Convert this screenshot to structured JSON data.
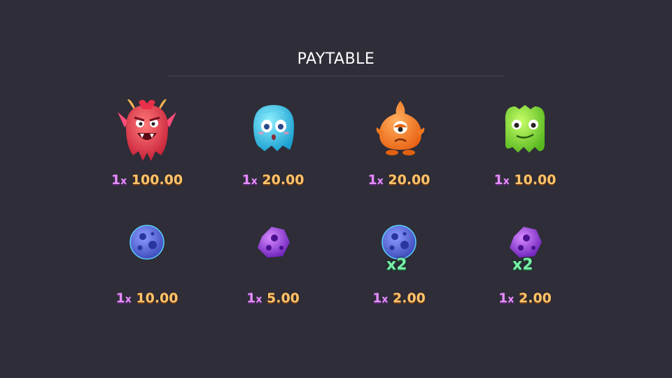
{
  "title": "PAYTABLE",
  "symbols": [
    {
      "icon": "red-devil-monster-icon",
      "count": "1",
      "x": "x",
      "payout": "100.00"
    },
    {
      "icon": "blue-ghost-monster-icon",
      "count": "1",
      "x": "x",
      "payout": "20.00"
    },
    {
      "icon": "orange-cyclops-monster-icon",
      "count": "1",
      "x": "x",
      "payout": "20.00"
    },
    {
      "icon": "green-blob-monster-icon",
      "count": "1",
      "x": "x",
      "payout": "10.00"
    },
    {
      "icon": "blue-moon-rock-icon",
      "count": "1",
      "x": "x",
      "payout": "10.00"
    },
    {
      "icon": "purple-asteroid-icon",
      "count": "1",
      "x": "x",
      "payout": "5.00"
    },
    {
      "icon": "blue-moon-rock-x2-icon",
      "count": "1",
      "x": "x",
      "payout": "2.00",
      "badge": "x2"
    },
    {
      "icon": "purple-asteroid-x2-icon",
      "count": "1",
      "x": "x",
      "payout": "2.00",
      "badge": "x2"
    }
  ]
}
